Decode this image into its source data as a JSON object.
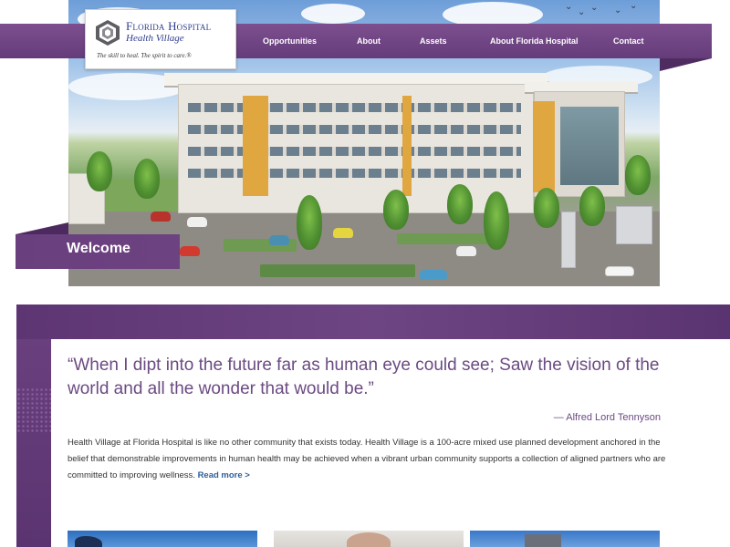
{
  "brand": {
    "title": "Florida Hospital",
    "subtitle": "Health Village",
    "tagline": "The skill to heal. The spirit to care.®"
  },
  "nav": {
    "items": [
      {
        "label": "Opportunities"
      },
      {
        "label": "About"
      },
      {
        "label": "Assets"
      },
      {
        "label": "About Florida Hospital"
      },
      {
        "label": "Contact"
      }
    ]
  },
  "hero": {
    "welcome_label": "Welcome"
  },
  "content": {
    "quote": "“When I dipt into the future far as human eye could see; Saw the vision of the world and all the wonder that would be.”",
    "attribution": "— Alfred Lord Tennyson",
    "body": "Health Village at Florida Hospital is like no other community that exists today.  Health Village is a 100-acre mixed use planned development anchored in the belief that demonstrable improvements in human health may be achieved when a vibrant urban community supports a collection of aligned partners who are committed to improving wellness. ",
    "read_more": "Read more >"
  },
  "colors": {
    "brand_purple": "#6a3f7e",
    "link_blue": "#2d5f9a",
    "quote_purple": "#6b4a82",
    "logo_blue": "#2f3f8f"
  },
  "icons": {
    "logo": "health-village-cube-logo"
  }
}
